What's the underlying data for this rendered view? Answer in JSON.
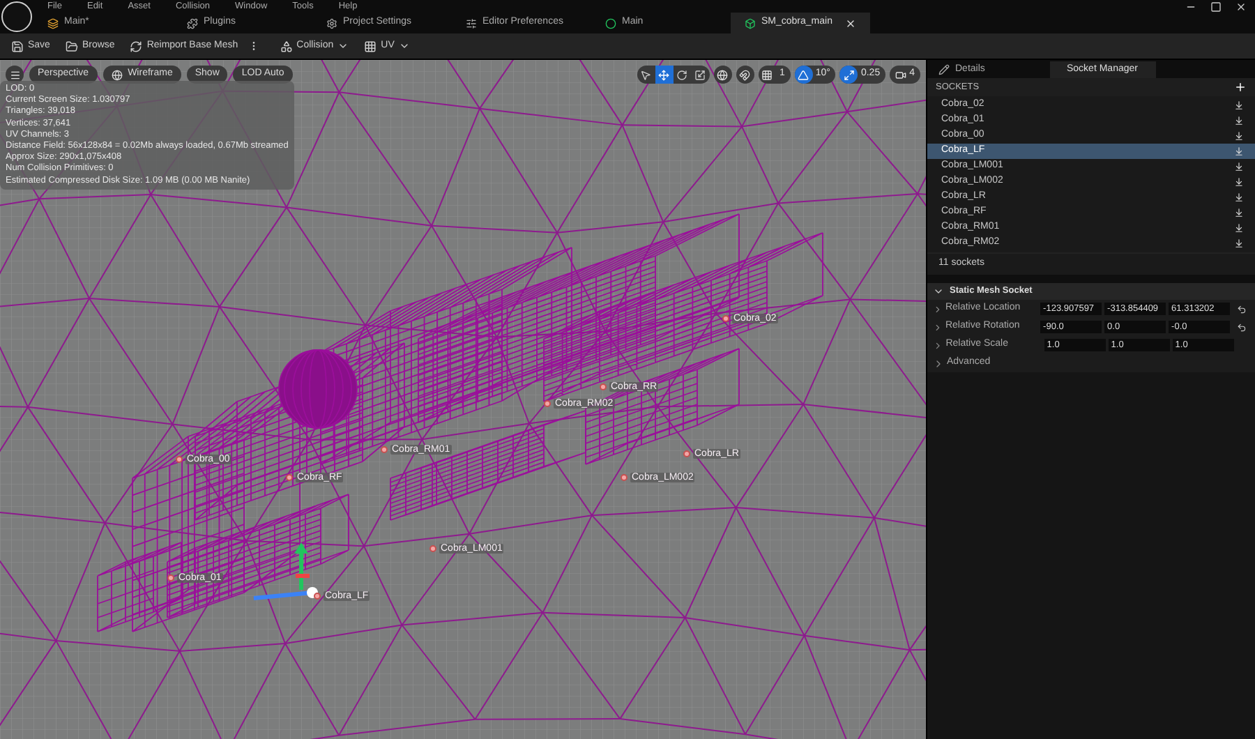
{
  "menu": [
    "File",
    "Edit",
    "Asset",
    "Collision",
    "Window",
    "Tools",
    "Help"
  ],
  "doc_tabs": [
    {
      "label": "Main*",
      "kind": "level",
      "selected": false,
      "closable": false
    },
    {
      "label": "Plugins",
      "kind": "plugin",
      "selected": false,
      "closable": false
    },
    {
      "label": "Project Settings",
      "kind": "settings",
      "selected": false,
      "closable": false
    },
    {
      "label": "Editor Preferences",
      "kind": "prefs",
      "selected": false,
      "closable": false
    },
    {
      "label": "Main",
      "kind": "blueprint",
      "selected": false,
      "closable": false
    },
    {
      "label": "SM_cobra_main",
      "kind": "mesh",
      "selected": true,
      "closable": true
    }
  ],
  "toolbar": [
    {
      "label": "Save",
      "kind": "save",
      "dropdown": false
    },
    {
      "label": "Browse",
      "kind": "browse",
      "dropdown": false
    },
    {
      "label": "Reimport Base Mesh",
      "kind": "reimport",
      "dropdown": false
    },
    {
      "label": "Collision",
      "kind": "collision",
      "dropdown": true
    },
    {
      "label": "UV",
      "kind": "uv",
      "dropdown": true
    }
  ],
  "viewport": {
    "options": [
      "Perspective",
      "Wireframe",
      "Show",
      "LOD Auto"
    ],
    "stats": [
      "LOD: 0",
      "Current Screen Size: 1.030797",
      "Triangles: 39,018",
      "Vertices: 37,641",
      "UV Channels: 3",
      "Distance Field: 56x128x84 = 0.02Mb always loaded, 0.67Mb streamed",
      "Approx Size: 290x1,075x408",
      "Num Collision Primitives: 0",
      "Estimated Compressed Disk Size: 1.09 MB (0.00 MB Nanite)"
    ],
    "transform_tools": [
      {
        "kind": "select",
        "selected": false
      },
      {
        "kind": "translate",
        "selected": true
      },
      {
        "kind": "rotate",
        "selected": false
      },
      {
        "kind": "scale",
        "selected": false
      }
    ],
    "snaps": [
      {
        "kind": "grid",
        "label": "1",
        "on": false
      },
      {
        "kind": "angle",
        "label": "10°",
        "on": true
      },
      {
        "kind": "scale",
        "label": "0.25",
        "on": true
      }
    ],
    "camera_speed": "4",
    "socket_markers": [
      {
        "label": "Cobra_02"
      },
      {
        "label": "Cobra_RR"
      },
      {
        "label": "Cobra_RM02"
      },
      {
        "label": "Cobra_RM01"
      },
      {
        "label": "Cobra_00"
      },
      {
        "label": "Cobra_RF"
      },
      {
        "label": "Cobra_LR"
      },
      {
        "label": "Cobra_LM002"
      },
      {
        "label": "Cobra_LM001"
      },
      {
        "label": "Cobra_01"
      },
      {
        "label": "Cobra_LF"
      }
    ]
  },
  "panel": {
    "tabs": [
      {
        "label": "Details",
        "kind": "details",
        "selected": false
      },
      {
        "label": "Socket Manager",
        "kind": "sockets",
        "selected": true
      }
    ],
    "sockets_header": "SOCKETS",
    "sockets": [
      {
        "label": "Cobra_02",
        "selected": false
      },
      {
        "label": "Cobra_01",
        "selected": false
      },
      {
        "label": "Cobra_00",
        "selected": false
      },
      {
        "label": "Cobra_LF",
        "selected": true
      },
      {
        "label": "Cobra_LM001",
        "selected": false
      },
      {
        "label": "Cobra_LM002",
        "selected": false
      },
      {
        "label": "Cobra_LR",
        "selected": false
      },
      {
        "label": "Cobra_RF",
        "selected": false
      },
      {
        "label": "Cobra_RM01",
        "selected": false
      },
      {
        "label": "Cobra_RM02",
        "selected": false
      }
    ],
    "socket_count": "11 sockets",
    "section": {
      "title": "Static Mesh Socket",
      "expanded": true
    },
    "properties": [
      {
        "label": "Relative Location",
        "values": [
          "-123.907597",
          "-313.854409",
          "61.313202"
        ],
        "resettable": true
      },
      {
        "label": "Relative Rotation",
        "values": [
          "-90.0",
          "0.0",
          "-0.0"
        ],
        "resettable": true
      },
      {
        "label": "Relative Scale",
        "values": [
          "1.0",
          "1.0",
          "1.0"
        ],
        "resettable": false
      }
    ],
    "advanced": {
      "label": "Advanced",
      "expanded": false
    }
  }
}
